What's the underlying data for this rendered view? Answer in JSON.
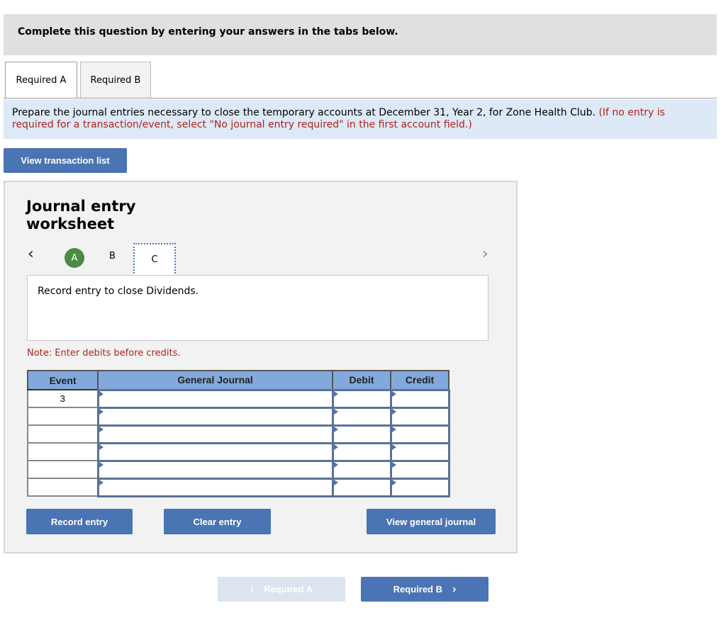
{
  "header": {
    "title": "Complete this question by entering your answers in the tabs below."
  },
  "tabs": [
    {
      "label": "Required A",
      "active": true
    },
    {
      "label": "Required B",
      "active": false
    }
  ],
  "instructions": {
    "text": "Prepare the journal entries necessary to close the temporary accounts at December 31, Year 2, for Zone Health Club.",
    "note": "(If no entry is required for a transaction/event, select \"No journal entry required\" in the first account field.)"
  },
  "view_transaction_list_label": "View transaction list",
  "worksheet": {
    "title_line1": "Journal entry",
    "title_line2": "worksheet",
    "nav_prev_icon": "‹",
    "nav_next_icon": "›",
    "steps": [
      {
        "label": "A",
        "state": "completed"
      },
      {
        "label": "B",
        "state": "default"
      },
      {
        "label": "C",
        "state": "current"
      }
    ],
    "description": "Record entry to close Dividends.",
    "note": "Note: Enter debits before credits.",
    "table": {
      "headers": [
        "Event",
        "General Journal",
        "Debit",
        "Credit"
      ],
      "rows": [
        {
          "event": "3",
          "account": "",
          "debit": "",
          "credit": ""
        },
        {
          "event": "",
          "account": "",
          "debit": "",
          "credit": ""
        },
        {
          "event": "",
          "account": "",
          "debit": "",
          "credit": ""
        },
        {
          "event": "",
          "account": "",
          "debit": "",
          "credit": ""
        },
        {
          "event": "",
          "account": "",
          "debit": "",
          "credit": ""
        },
        {
          "event": "",
          "account": "",
          "debit": "",
          "credit": ""
        }
      ]
    },
    "buttons": {
      "record": "Record entry",
      "clear": "Clear entry",
      "view_journal": "View general journal"
    }
  },
  "footer_nav": {
    "prev_label": "Required A",
    "prev_icon": "‹",
    "prev_disabled": true,
    "next_label": "Required B",
    "next_icon": "›"
  },
  "colors": {
    "button_blue": "#4a74b3",
    "header_blue": "#82a9dc",
    "instruction_bg": "#dde9f6",
    "warning_red": "#b0231f",
    "step_green": "#4b8a43"
  }
}
